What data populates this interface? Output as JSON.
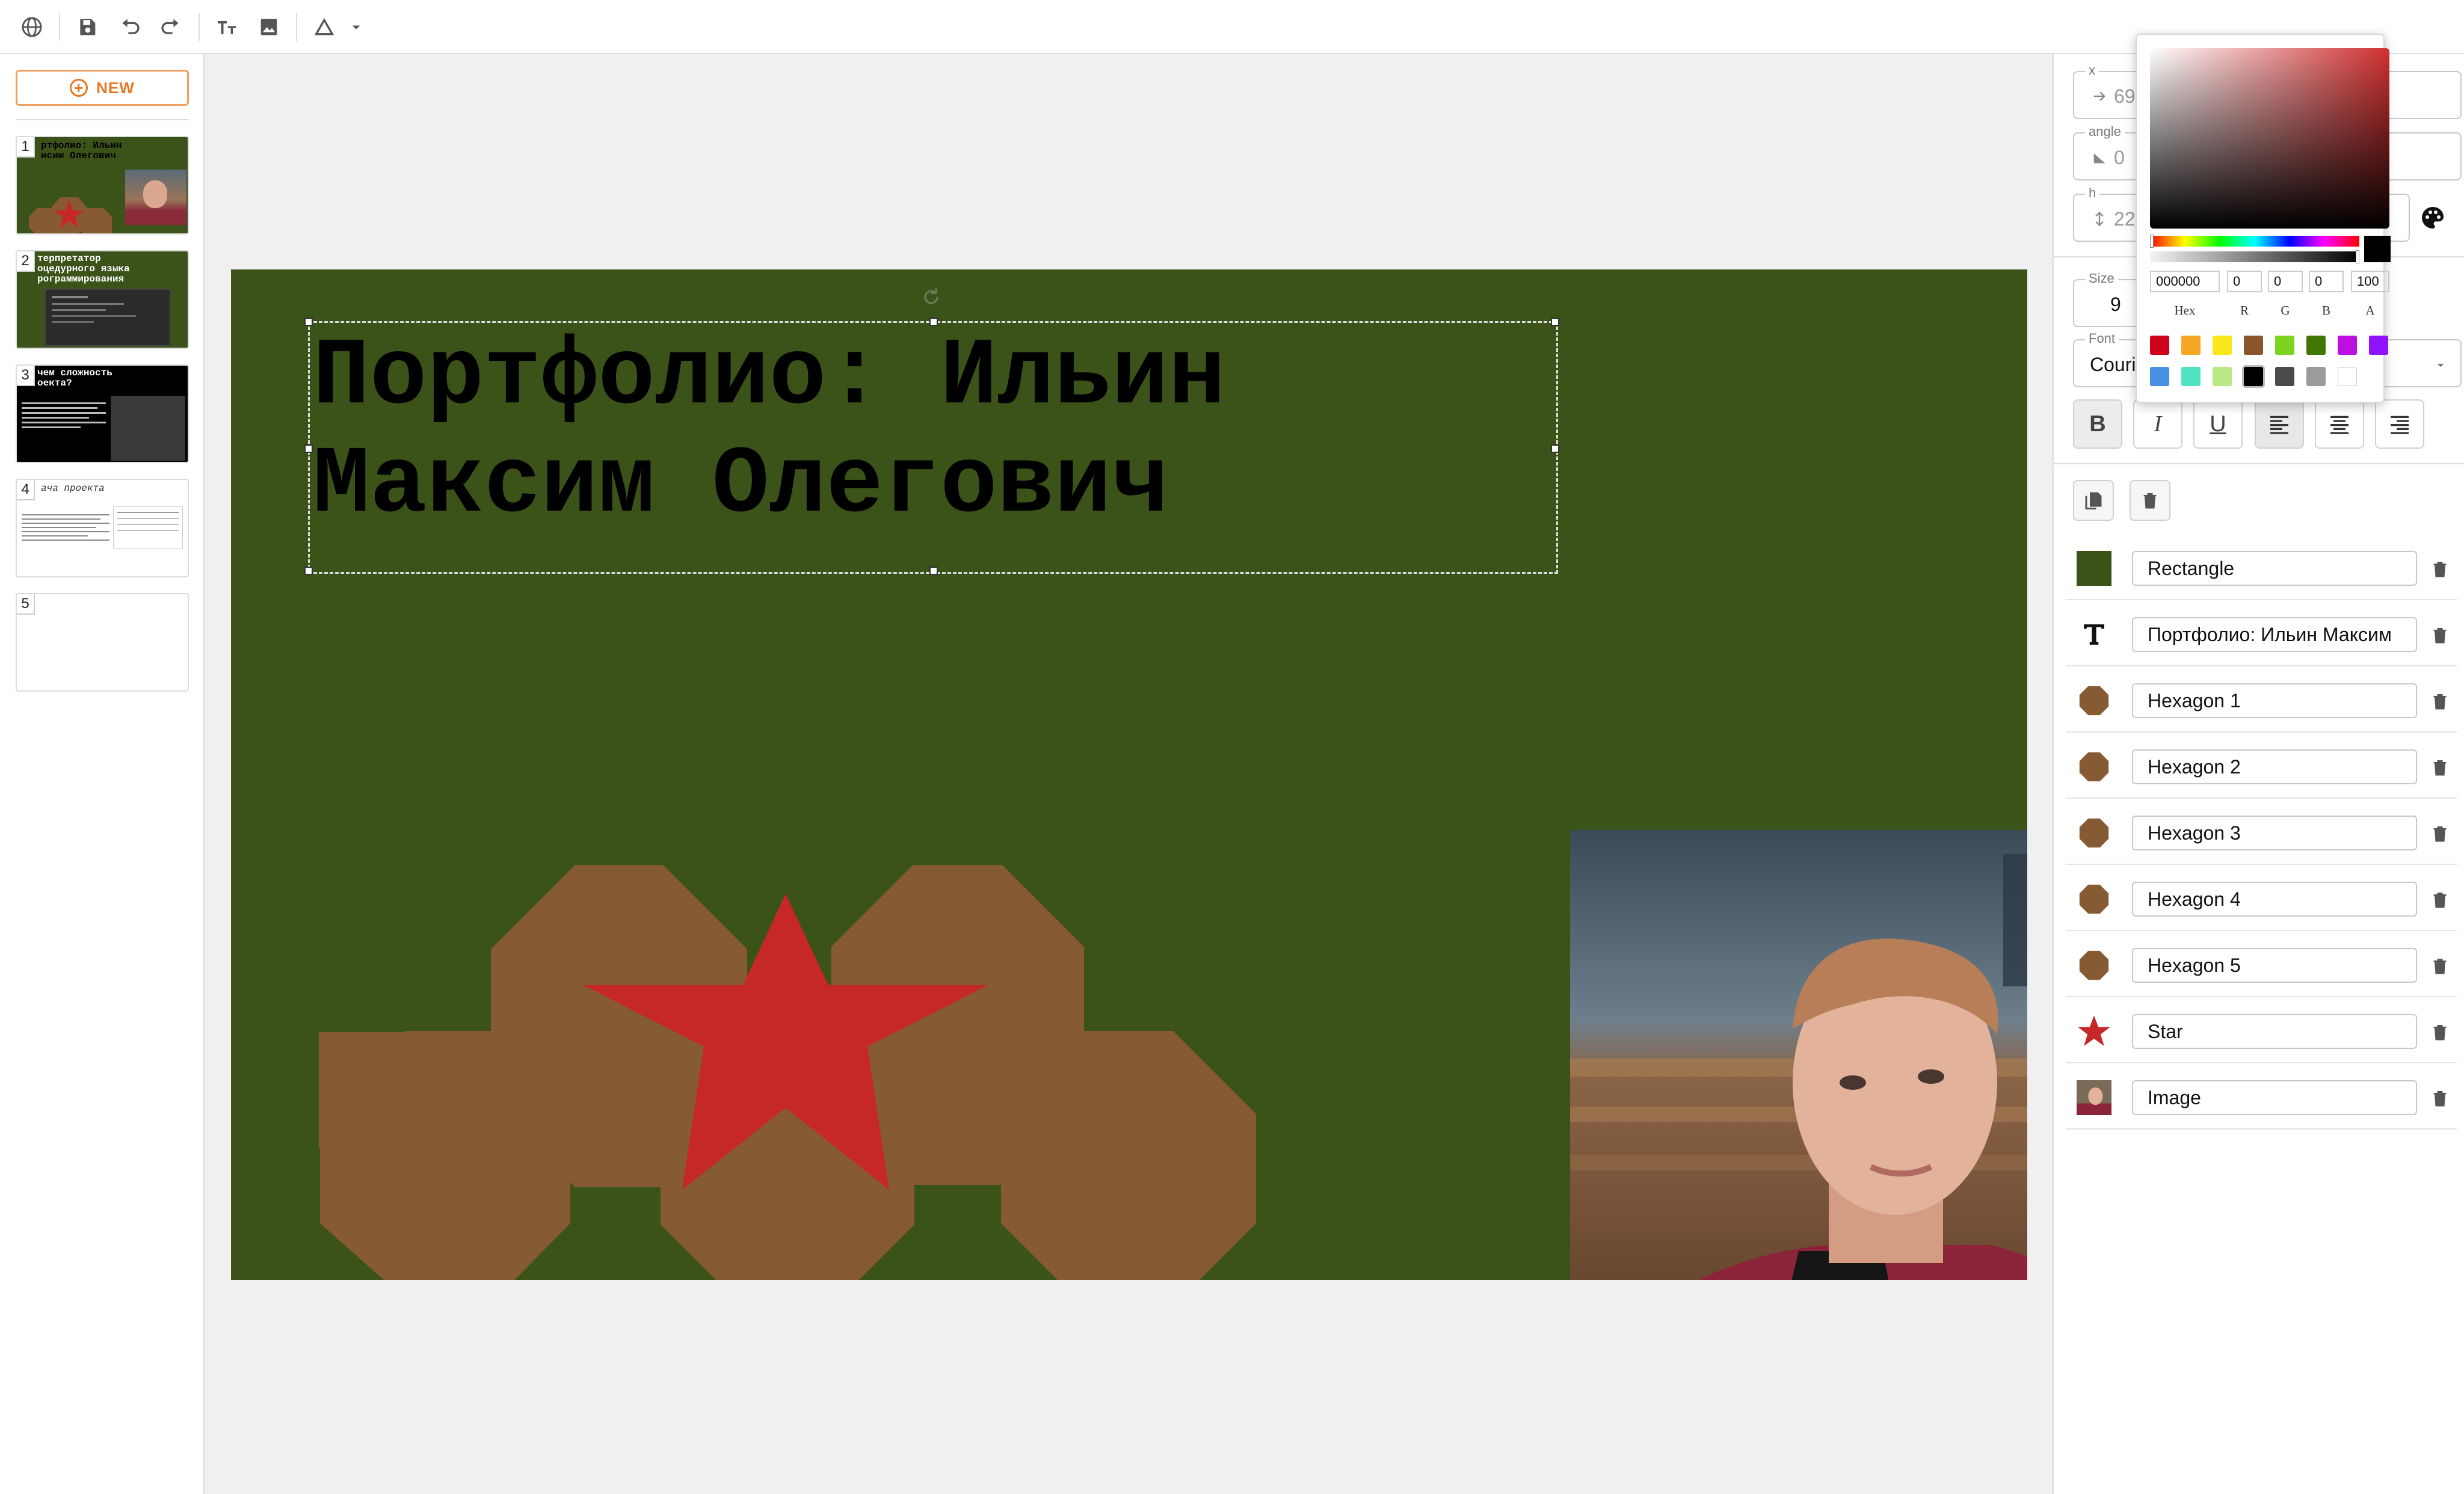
{
  "toolbar": {
    "icons": [
      "globe-icon",
      "save-icon",
      "undo-icon",
      "redo-icon",
      "text-icon",
      "image-icon",
      "shape-icon",
      "chevron-down-icon"
    ]
  },
  "sidebar": {
    "new_label": "NEW",
    "slides": [
      {
        "number": "1",
        "title": "ртфолио: Ильин\nисим Олегович"
      },
      {
        "number": "2",
        "title": "терпретатор\nоцедурного языка\nрограммирования"
      },
      {
        "number": "3",
        "title": "чем сложность\nоекта?"
      },
      {
        "number": "4",
        "title": "ача проекта"
      },
      {
        "number": "5",
        "title": ""
      }
    ]
  },
  "slide": {
    "title": "Портфолио: Ильин Максим Олегович",
    "background": "#3b5219",
    "hexagon_color": "#865a32",
    "star_color": "#c62828"
  },
  "properties": {
    "x_label": "x",
    "x_value": "69",
    "angle_label": "angle",
    "angle_value": "0",
    "h_label": "h",
    "h_value": "22",
    "size_label": "Size",
    "size_value": "9",
    "font_label": "Font",
    "font_value": "Couri",
    "format_buttons": [
      "B",
      "I",
      "U"
    ]
  },
  "color_picker": {
    "hex": "000000",
    "r": "0",
    "g": "0",
    "b": "0",
    "a": "100",
    "labels": {
      "hex": "Hex",
      "r": "R",
      "g": "G",
      "b": "B",
      "a": "A"
    },
    "swatches": [
      "#d0021b",
      "#f5a623",
      "#f8e71c",
      "#8b572a",
      "#7ed321",
      "#417505",
      "#bd10e0",
      "#9013fe",
      "#4a90e2",
      "#50e3c2",
      "#b8e986",
      "#000000",
      "#4a4a4a",
      "#9b9b9b",
      "#ffffff"
    ]
  },
  "layers": [
    {
      "name": "Rectangle",
      "icon": "rectangle-icon"
    },
    {
      "name": "Портфолио: Ильин Максим",
      "icon": "text-layer-icon"
    },
    {
      "name": "Hexagon 1",
      "icon": "hexagon-icon"
    },
    {
      "name": "Hexagon 2",
      "icon": "hexagon-icon"
    },
    {
      "name": "Hexagon 3",
      "icon": "hexagon-icon"
    },
    {
      "name": "Hexagon 4",
      "icon": "hexagon-icon"
    },
    {
      "name": "Hexagon 5",
      "icon": "hexagon-icon"
    },
    {
      "name": "Star",
      "icon": "star-icon"
    },
    {
      "name": "Image",
      "icon": "image-thumb-icon"
    }
  ]
}
